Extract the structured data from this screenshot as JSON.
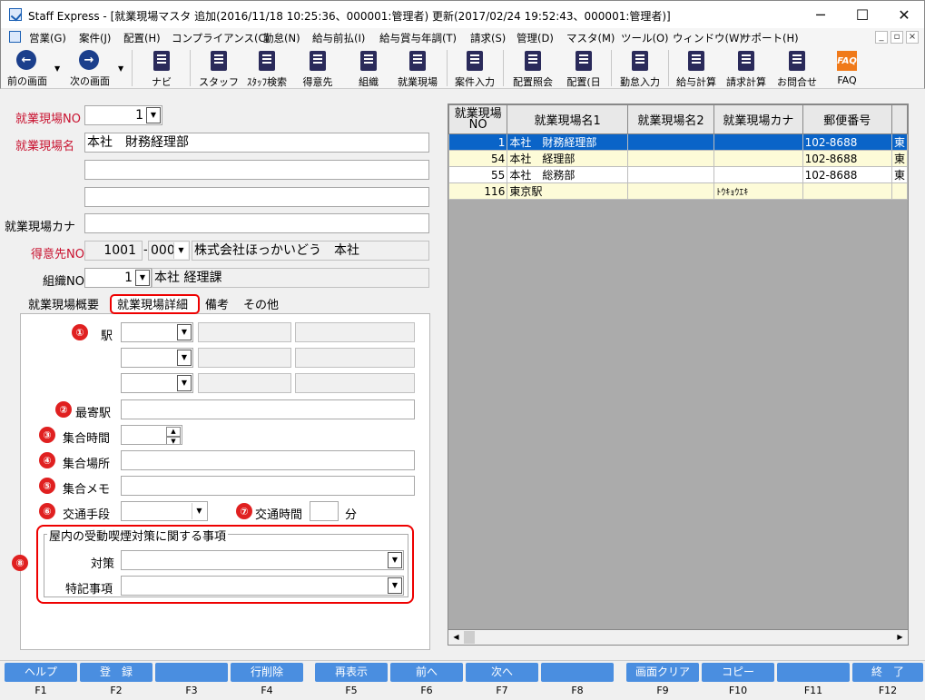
{
  "window": {
    "title": "Staff Express - [就業現場マスタ 追加(2016/11/18 10:25:36、000001:管理者) 更新(2017/02/24 19:52:43、000001:管理者)]",
    "minimize": "─",
    "maximize": "☐",
    "close": "✕"
  },
  "menu": [
    "営業(G)",
    "案件(J)",
    "配置(H)",
    "コンプライアンス(C)",
    "勤怠(N)",
    "給与前払(I)",
    "給与賞与年調(T)",
    "請求(S)",
    "管理(D)",
    "マスタ(M)",
    "ツール(O)",
    "ウィンドウ(W)",
    "サポート(H)"
  ],
  "mdi": {
    "minimize": "_",
    "restore": "▫",
    "close": "×"
  },
  "toolbar": {
    "prev": "前の画面",
    "next": "次の画面",
    "navi": "ナビ",
    "staff": "スタッフ",
    "staff_search": "ｽﾀｯﾌ検索",
    "customer": "得意先",
    "org": "組織",
    "site": "就業現場",
    "job_entry": "案件入力",
    "assign_inquiry": "配置照会",
    "assign_day": "配置(日",
    "attendance": "勤怠入力",
    "payroll": "給与計算",
    "billing": "請求計算",
    "inquiry": "お問合せ",
    "faq": "FAQ",
    "faq_icon_text": "FAQ"
  },
  "form": {
    "site_no_label": "就業現場NO",
    "site_no": "1",
    "site_name_label": "就業現場名",
    "site_name": "本社　財務経理部",
    "site_name2": "",
    "site_name3": "",
    "site_kana_label": "就業現場カナ",
    "site_kana": "",
    "customer_no_label": "得意先NO",
    "customer_no": "1001",
    "customer_branch": "000",
    "customer_name": "株式会社ほっかいどう　本社",
    "dash": "-",
    "org_no_label": "組織NO",
    "org_no": "1",
    "org_name": "本社 経理課"
  },
  "tabs": [
    "就業現場概要",
    "就業現場詳細",
    "備考",
    "その他"
  ],
  "detail": {
    "station_label": "駅",
    "nearest_label": "最寄駅",
    "meet_time_label": "集合時間",
    "meet_place_label": "集合場所",
    "meet_memo_label": "集合メモ",
    "transport_label": "交通手段",
    "travel_time_label": "交通時間",
    "minutes_unit": "分",
    "smoking_group_title": "屋内の受動喫煙対策に関する事項",
    "measure_label": "対策",
    "note_label": "特記事項"
  },
  "markers": [
    "①",
    "②",
    "③",
    "④",
    "⑤",
    "⑥",
    "⑦",
    "⑧"
  ],
  "grid": {
    "headers": [
      "就業現場\nNO",
      "就業現場名1",
      "就業現場名2",
      "就業現場カナ",
      "郵便番号",
      ""
    ],
    "rows": [
      {
        "no": "1",
        "name1": "本社　財務経理部",
        "name2": "",
        "kana": "",
        "zip": "102-8688",
        "extra": "東"
      },
      {
        "no": "54",
        "name1": "本社　経理部",
        "name2": "",
        "kana": "",
        "zip": "102-8688",
        "extra": "東"
      },
      {
        "no": "55",
        "name1": "本社　総務部",
        "name2": "",
        "kana": "",
        "zip": "102-8688",
        "extra": "東"
      },
      {
        "no": "116",
        "name1": "東京駅",
        "name2": "",
        "kana": "ﾄｳｷｮｳｴｷ",
        "zip": "",
        "extra": ""
      }
    ]
  },
  "fkeys": [
    {
      "label": "ヘルプ",
      "key": "F1"
    },
    {
      "label": "登　録",
      "key": "F2"
    },
    {
      "label": "",
      "key": "F3"
    },
    {
      "label": "行削除",
      "key": "F4"
    },
    {
      "label": "再表示",
      "key": "F5"
    },
    {
      "label": "前へ",
      "key": "F6"
    },
    {
      "label": "次へ",
      "key": "F7"
    },
    {
      "label": "",
      "key": "F8"
    },
    {
      "label": "画面クリア",
      "key": "F9"
    },
    {
      "label": "コピー",
      "key": "F10"
    },
    {
      "label": "",
      "key": "F11"
    },
    {
      "label": "終　了",
      "key": "F12"
    }
  ]
}
